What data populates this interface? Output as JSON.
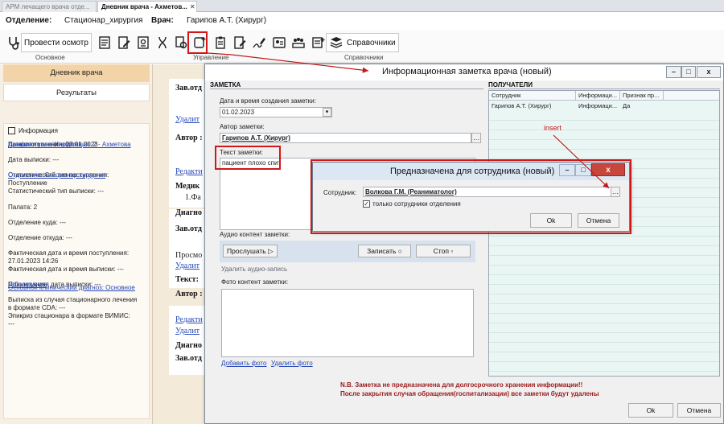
{
  "tabs": [
    {
      "label": "АРМ лечащего врача отде..."
    },
    {
      "label": "Дневник врача - Ахметов..."
    }
  ],
  "header": {
    "dept_label": "Отделение:",
    "dept_value": "Стационар_хирургия",
    "doctor_label": "Врач:",
    "doctor_value": "Гарипов А.Т. (Хирург)"
  },
  "toolbar": {
    "exam_label": "Провести осмотр",
    "refs_label": "Справочники",
    "group_main": "Основное",
    "group_manage": "Управление",
    "group_refs": "Справочники"
  },
  "left": {
    "nav": [
      "Дневник врача",
      "Результаты"
    ],
    "info_title": "Информация",
    "rows": [
      {
        "text": "Данные по госпитализации: 2 - Ахметова",
        "link": true
      },
      {
        "text": "Профили коек: Хирургия",
        "link": true
      },
      {
        "text": "Дата поступления: 27.01.2023",
        "link": false
      },
      {
        "text": "Дата выписки: ---",
        "link": false
      },
      {
        "text": "Отделение: Стационар хирургия",
        "link": true
      },
      {
        "text": "Статистический тип поступления:",
        "link": false
      },
      {
        "text": "Поступление",
        "link": false
      },
      {
        "text": "Статистический тип выписки: ---",
        "link": false
      },
      {
        "text": "Палата: 2",
        "link": false
      },
      {
        "text": "Отделение куда: ---",
        "link": false
      },
      {
        "text": "Отделение откуда: ---",
        "link": false
      },
      {
        "text": "Фактическая дата и время поступления:",
        "link": false
      },
      {
        "text": "27.01.2023 14:26",
        "link": false
      },
      {
        "text": "Фактическая дата и время выписки: ---",
        "link": false
      },
      {
        "text": "Основной клинический диагноз: Основное",
        "link": true
      },
      {
        "text": "заболевание",
        "link": true
      },
      {
        "text": "Планируемая дата выписки: ---",
        "link": false
      },
      {
        "text": "Выписка из случая стационарного лечения",
        "link": false
      },
      {
        "text": "в формате CDA: ---",
        "link": false
      },
      {
        "text": "Эпикриз стационара в формате ВИМИС:",
        "link": false
      },
      {
        "text": "---",
        "link": false
      }
    ]
  },
  "diary": {
    "lines": [
      {
        "text": "Зав.отд",
        "type": "bold"
      },
      {
        "text": "Удалит",
        "type": "link"
      },
      {
        "text": "Автор :",
        "type": "bold"
      },
      {
        "text": "Редакти",
        "type": "link"
      },
      {
        "text": "Медик",
        "type": "bold"
      },
      {
        "text": "1.Фа",
        "type": "plain"
      },
      {
        "text": "Диагно",
        "type": "bold"
      },
      {
        "text": "Зав.отд",
        "type": "bold"
      },
      {
        "text": "Просмо",
        "type": "plain"
      },
      {
        "text": "Удалит",
        "type": "link"
      },
      {
        "text": "Текст:",
        "type": "bold"
      },
      {
        "text": "Автор :",
        "type": "bold"
      },
      {
        "text": "Редакти",
        "type": "link"
      },
      {
        "text": "Удалит",
        "type": "link"
      },
      {
        "text": "Диагно",
        "type": "bold"
      },
      {
        "text": "Зав.отд",
        "type": "bold"
      }
    ]
  },
  "dialog": {
    "title": "Информационная заметка врача (новый)",
    "note_section": "ЗАМЕТКА",
    "date_label": "Дата и время создания заметки:",
    "date_value": "01.02.2023",
    "author_label": "Автор заметки:",
    "author_value": "Гарипов А.Т. (Хирург)",
    "text_label": "Текст заметки:",
    "text_value": "пациент плохо спит",
    "audio_label": "Аудио контент заметки:",
    "listen_label": "Прослушать",
    "record_label": "Записать",
    "stop_label": "Стоп",
    "delete_audio": "Удалить аудио-запись",
    "photo_label": "Фото контент заметки:",
    "add_photo": "Добавить фото",
    "delete_photo": "Удалить фото",
    "recipients_section": "ПОЛУЧАТЕЛИ",
    "grid_headers": [
      "Сотрудник",
      "Информаци...",
      "Признак пр..."
    ],
    "grid_row": [
      "Гарипов А.Т. (Хирург)",
      "Информаци...",
      "Да"
    ],
    "footer_note_1": "N.B. Заметка не предназначена для долгосрочного хранения информации!!",
    "footer_note_2": "После закрытия случая обращения(госпитализации) все заметки будут удалены",
    "ok_label": "Ok",
    "cancel_label": "Отмена"
  },
  "sub_dialog": {
    "title": "Предназначена для сотрудника (новый)",
    "employee_label": "Сотрудник:",
    "employee_value": "Волкова Г.М. (Реаниматолог)",
    "only_dept_label": "только сотрудники отделения",
    "ok_label": "Ok",
    "cancel_label": "Отмена"
  },
  "annotation": {
    "insert_label": "insert"
  },
  "colors": {
    "accent": "#f3d4a8",
    "highlight": "#d01818",
    "link": "#2547b8"
  }
}
